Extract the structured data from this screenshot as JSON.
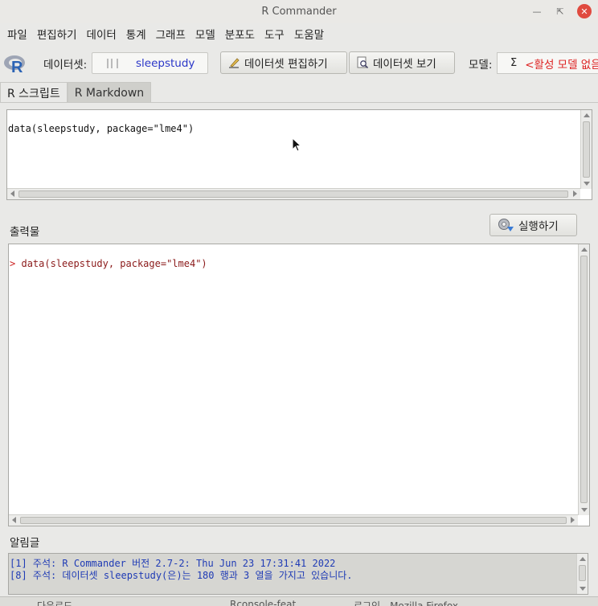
{
  "window": {
    "title": "R Commander"
  },
  "menu": [
    "파일",
    "편집하기",
    "데이터",
    "통계",
    "그래프",
    "모델",
    "분포도",
    "도구",
    "도움말"
  ],
  "toolbar": {
    "dataset_label": "데이터셋:",
    "dataset_value": "sleepstudy",
    "edit_dataset_button": "데이터셋 편집하기",
    "view_dataset_button": "데이터셋 보기",
    "model_label": "모델:",
    "model_symbol": "Σ",
    "model_value": "<활성 모델 없음>"
  },
  "tabs": [
    "R 스크립트",
    "R Markdown"
  ],
  "script": {
    "text": "data(sleepstudy, package=\"lme4\")"
  },
  "run_button": "실행하기",
  "output": {
    "label": "출력물",
    "prompt": ">",
    "command": "data(sleepstudy, package=\"lme4\")"
  },
  "messages": {
    "label": "알림글",
    "lines": [
      "[1] 주석: R Commander 버전 2.7-2: Thu Jun 23 17:31:41 2022",
      "[8] 주석: 데이터셋 sleepstudy(은)는 180 행과 3 열을 가지고 있습니다."
    ]
  },
  "taskbar": [
    "다운로드",
    "Rconsole-feat",
    "로그인 - Mozilla Firefox"
  ],
  "colors": {
    "dataset_value": "#2a36c8",
    "model_value": "#dd2222",
    "output_command": "#8b1a1a",
    "messages_text": "#1f3bb5",
    "close_button": "#e04a3f"
  }
}
